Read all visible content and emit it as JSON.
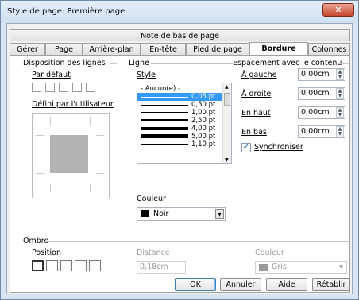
{
  "window": {
    "title": "Style de page: Première page",
    "close_glyph": "✕"
  },
  "tabs_row1": [
    "Note de bas de page"
  ],
  "tabs_row2": [
    "Gérer",
    "Page",
    "Arrière-plan",
    "En-tête",
    "Pied de page",
    "Bordure",
    "Colonnes"
  ],
  "active_tab": "Bordure",
  "line_arrangement": {
    "header": "Disposition des lignes",
    "default_label": "Par défaut",
    "user_label": "Défini par l'utilisateur"
  },
  "line": {
    "header": "Ligne",
    "style_label": "Style",
    "styles": [
      "- Aucun(e) -",
      "0,05 pt",
      "0,50 pt",
      "1,00 pt",
      "2,50 pt",
      "4,00 pt",
      "5,00 pt",
      "1,10 pt"
    ],
    "selected_style": "0,05 pt",
    "color_label": "Couleur",
    "color_value": "Noir",
    "color_swatch": "#000000"
  },
  "spacing": {
    "header": "Espacement avec le contenu",
    "left_label": "À gauche",
    "left_value": "0,00cm",
    "right_label": "À droite",
    "right_value": "0,00cm",
    "top_label": "En haut",
    "top_value": "0,00cm",
    "bottom_label": "En bas",
    "bottom_value": "0,00cm",
    "sync_label": "Synchroniser",
    "sync_checked": true
  },
  "shadow": {
    "header": "Ombre",
    "position_label": "Position",
    "distance_label": "Distance",
    "distance_value": "0,18cm",
    "color_label": "Couleur",
    "color_value": "Gris",
    "color_swatch": "#808080"
  },
  "buttons": {
    "ok": "OK",
    "cancel": "Annuler",
    "help": "Aide",
    "reset": "Rétablir"
  },
  "icons": {
    "dropdown": "▼",
    "spin_up": "▲",
    "spin_down": "▼",
    "check": "✓"
  }
}
